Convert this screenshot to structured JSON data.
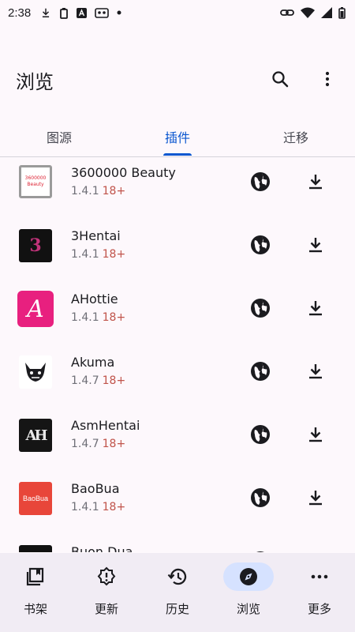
{
  "status_bar": {
    "time": "2:38"
  },
  "header": {
    "title": "浏览",
    "search_icon": "search-icon",
    "more_icon": "more-vert-icon"
  },
  "tabs": [
    {
      "label": "图源",
      "active": false
    },
    {
      "label": "插件",
      "active": true
    },
    {
      "label": "迁移",
      "active": false
    }
  ],
  "extensions": [
    {
      "name": "3600000 Beauty",
      "version": "1.4.1",
      "nsfw": "18+",
      "logo_text": "3600000 Beauty"
    },
    {
      "name": "3Hentai",
      "version": "1.4.1",
      "nsfw": "18+",
      "logo_text": "3"
    },
    {
      "name": "AHottie",
      "version": "1.4.1",
      "nsfw": "18+",
      "logo_text": "A"
    },
    {
      "name": "Akuma",
      "version": "1.4.7",
      "nsfw": "18+",
      "logo_text": ""
    },
    {
      "name": "AsmHentai",
      "version": "1.4.7",
      "nsfw": "18+",
      "logo_text": "AH"
    },
    {
      "name": "BaoBua",
      "version": "1.4.1",
      "nsfw": "18+",
      "logo_text": "BaoBua"
    },
    {
      "name": "Buon Dua",
      "version": "",
      "nsfw": "",
      "logo_text": ""
    }
  ],
  "bottom_nav": [
    {
      "label": "书架",
      "icon": "library-icon",
      "active": false
    },
    {
      "label": "更新",
      "icon": "updates-icon",
      "active": false
    },
    {
      "label": "历史",
      "icon": "history-icon",
      "active": false
    },
    {
      "label": "浏览",
      "icon": "explore-icon",
      "active": true
    },
    {
      "label": "更多",
      "icon": "more-horiz-icon",
      "active": false
    }
  ],
  "colors": {
    "accent": "#0b57d0",
    "nsfw": "#c0534a",
    "nav_active_pill": "#d6e2ff",
    "background": "#fdf8fc"
  }
}
